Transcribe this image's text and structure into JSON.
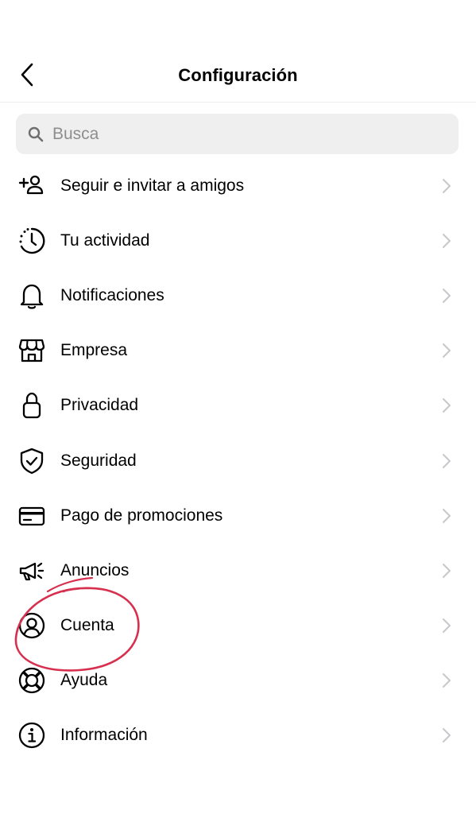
{
  "header": {
    "title": "Configuración",
    "back_icon": "chevron-left-icon"
  },
  "search": {
    "placeholder": "Busca",
    "value": "",
    "icon": "search-icon"
  },
  "menu": {
    "items": [
      {
        "label": "Seguir e invitar a amigos",
        "icon": "add-person-icon"
      },
      {
        "label": "Tu actividad",
        "icon": "activity-clock-icon"
      },
      {
        "label": "Notificaciones",
        "icon": "bell-icon"
      },
      {
        "label": "Empresa",
        "icon": "shop-icon"
      },
      {
        "label": "Privacidad",
        "icon": "lock-icon"
      },
      {
        "label": "Seguridad",
        "icon": "shield-check-icon"
      },
      {
        "label": "Pago de promociones",
        "icon": "credit-card-icon"
      },
      {
        "label": "Anuncios",
        "icon": "megaphone-icon"
      },
      {
        "label": "Cuenta",
        "icon": "account-circle-icon"
      },
      {
        "label": "Ayuda",
        "icon": "lifebuoy-icon"
      },
      {
        "label": "Información",
        "icon": "info-icon"
      }
    ]
  },
  "colors": {
    "background": "#ffffff",
    "search_background": "#efefef",
    "placeholder": "#8e8e8e",
    "chevron": "#c7c7cc",
    "annotation_circle": "#d7304f"
  }
}
